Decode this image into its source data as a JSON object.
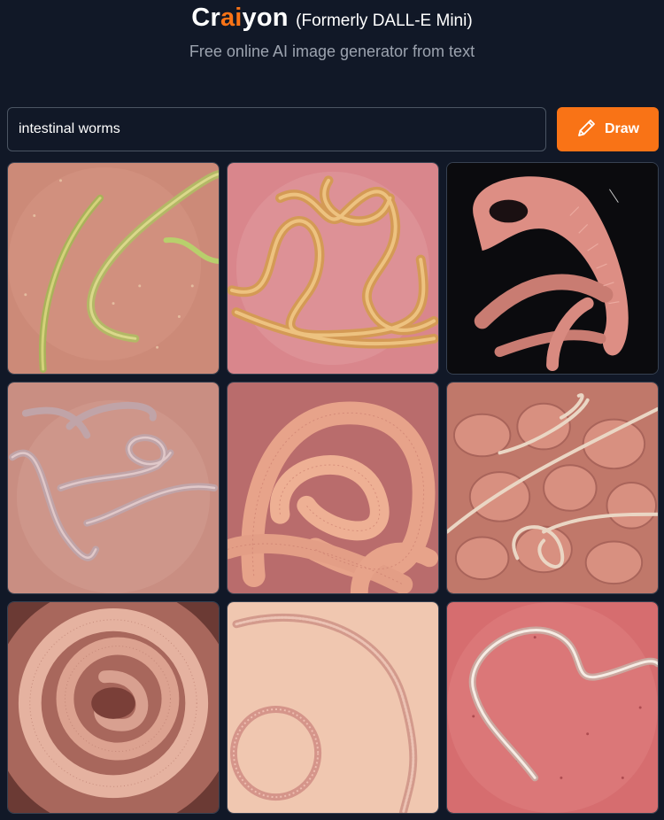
{
  "header": {
    "brand_prefix": "Cr",
    "brand_accent": "ai",
    "brand_suffix": "yon",
    "formerly": "(Formerly DALL-E Mini)",
    "subtitle": "Free online AI image generator from text"
  },
  "search": {
    "value": "intestinal worms",
    "button_label": "Draw",
    "button_icon": "pencil-icon"
  },
  "colors": {
    "background": "#111827",
    "accent": "#f97316"
  },
  "results": [
    {
      "name": "generated-image-1"
    },
    {
      "name": "generated-image-2"
    },
    {
      "name": "generated-image-3"
    },
    {
      "name": "generated-image-4"
    },
    {
      "name": "generated-image-5"
    },
    {
      "name": "generated-image-6"
    },
    {
      "name": "generated-image-7"
    },
    {
      "name": "generated-image-8"
    },
    {
      "name": "generated-image-9"
    }
  ]
}
